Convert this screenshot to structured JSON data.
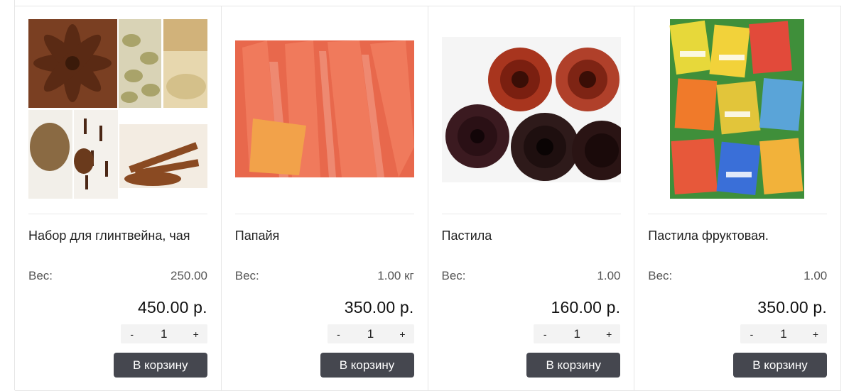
{
  "weight_label": "Вес:",
  "products": [
    {
      "image_alt": "spices-collage",
      "title": "Набор для глинтвейна, чая",
      "weight": "250.00",
      "price": "450.00 р.",
      "qty_minus": "-",
      "qty": "1",
      "qty_plus": "+",
      "cart_label": "В корзину"
    },
    {
      "image_alt": "dried-papaya",
      "title": "Папайя",
      "weight": "1.00 кг",
      "price": "350.00 р.",
      "qty_minus": "-",
      "qty": "1",
      "qty_plus": "+",
      "cart_label": "В корзину"
    },
    {
      "image_alt": "fruit-leather-rolls",
      "title": "Пастила",
      "weight": "1.00",
      "price": "160.00 р.",
      "qty_minus": "-",
      "qty": "1",
      "qty_plus": "+",
      "cart_label": "В корзину"
    },
    {
      "image_alt": "pastila-candies",
      "title": "Пастила фруктовая.",
      "weight": "1.00",
      "price": "350.00 р.",
      "qty_minus": "-",
      "qty": "1",
      "qty_plus": "+",
      "cart_label": "В корзину"
    }
  ],
  "colors": {
    "button_bg": "#45474f",
    "border": "#e6e6e6",
    "qty_bg": "#f3f3f3"
  }
}
